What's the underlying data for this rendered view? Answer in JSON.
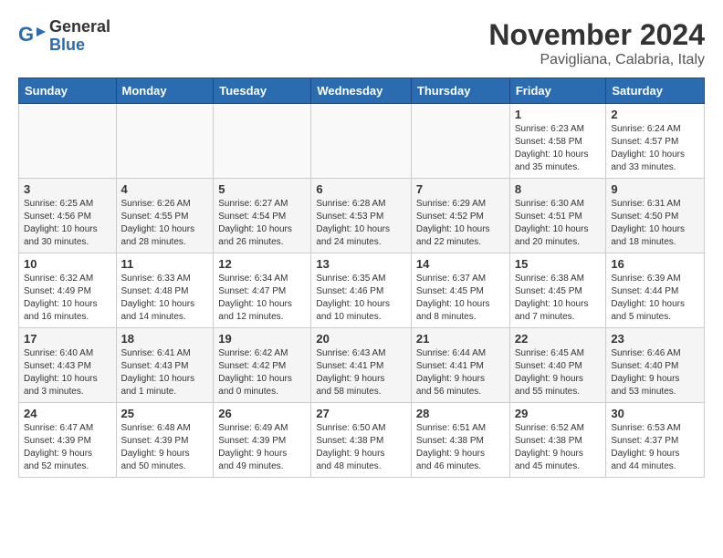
{
  "header": {
    "logo_general": "General",
    "logo_blue": "Blue",
    "month_title": "November 2024",
    "location": "Pavigliana, Calabria, Italy"
  },
  "days_of_week": [
    "Sunday",
    "Monday",
    "Tuesday",
    "Wednesday",
    "Thursday",
    "Friday",
    "Saturday"
  ],
  "weeks": [
    [
      {
        "day": "",
        "info": ""
      },
      {
        "day": "",
        "info": ""
      },
      {
        "day": "",
        "info": ""
      },
      {
        "day": "",
        "info": ""
      },
      {
        "day": "",
        "info": ""
      },
      {
        "day": "1",
        "info": "Sunrise: 6:23 AM\nSunset: 4:58 PM\nDaylight: 10 hours\nand 35 minutes."
      },
      {
        "day": "2",
        "info": "Sunrise: 6:24 AM\nSunset: 4:57 PM\nDaylight: 10 hours\nand 33 minutes."
      }
    ],
    [
      {
        "day": "3",
        "info": "Sunrise: 6:25 AM\nSunset: 4:56 PM\nDaylight: 10 hours\nand 30 minutes."
      },
      {
        "day": "4",
        "info": "Sunrise: 6:26 AM\nSunset: 4:55 PM\nDaylight: 10 hours\nand 28 minutes."
      },
      {
        "day": "5",
        "info": "Sunrise: 6:27 AM\nSunset: 4:54 PM\nDaylight: 10 hours\nand 26 minutes."
      },
      {
        "day": "6",
        "info": "Sunrise: 6:28 AM\nSunset: 4:53 PM\nDaylight: 10 hours\nand 24 minutes."
      },
      {
        "day": "7",
        "info": "Sunrise: 6:29 AM\nSunset: 4:52 PM\nDaylight: 10 hours\nand 22 minutes."
      },
      {
        "day": "8",
        "info": "Sunrise: 6:30 AM\nSunset: 4:51 PM\nDaylight: 10 hours\nand 20 minutes."
      },
      {
        "day": "9",
        "info": "Sunrise: 6:31 AM\nSunset: 4:50 PM\nDaylight: 10 hours\nand 18 minutes."
      }
    ],
    [
      {
        "day": "10",
        "info": "Sunrise: 6:32 AM\nSunset: 4:49 PM\nDaylight: 10 hours\nand 16 minutes."
      },
      {
        "day": "11",
        "info": "Sunrise: 6:33 AM\nSunset: 4:48 PM\nDaylight: 10 hours\nand 14 minutes."
      },
      {
        "day": "12",
        "info": "Sunrise: 6:34 AM\nSunset: 4:47 PM\nDaylight: 10 hours\nand 12 minutes."
      },
      {
        "day": "13",
        "info": "Sunrise: 6:35 AM\nSunset: 4:46 PM\nDaylight: 10 hours\nand 10 minutes."
      },
      {
        "day": "14",
        "info": "Sunrise: 6:37 AM\nSunset: 4:45 PM\nDaylight: 10 hours\nand 8 minutes."
      },
      {
        "day": "15",
        "info": "Sunrise: 6:38 AM\nSunset: 4:45 PM\nDaylight: 10 hours\nand 7 minutes."
      },
      {
        "day": "16",
        "info": "Sunrise: 6:39 AM\nSunset: 4:44 PM\nDaylight: 10 hours\nand 5 minutes."
      }
    ],
    [
      {
        "day": "17",
        "info": "Sunrise: 6:40 AM\nSunset: 4:43 PM\nDaylight: 10 hours\nand 3 minutes."
      },
      {
        "day": "18",
        "info": "Sunrise: 6:41 AM\nSunset: 4:43 PM\nDaylight: 10 hours\nand 1 minute."
      },
      {
        "day": "19",
        "info": "Sunrise: 6:42 AM\nSunset: 4:42 PM\nDaylight: 10 hours\nand 0 minutes."
      },
      {
        "day": "20",
        "info": "Sunrise: 6:43 AM\nSunset: 4:41 PM\nDaylight: 9 hours\nand 58 minutes."
      },
      {
        "day": "21",
        "info": "Sunrise: 6:44 AM\nSunset: 4:41 PM\nDaylight: 9 hours\nand 56 minutes."
      },
      {
        "day": "22",
        "info": "Sunrise: 6:45 AM\nSunset: 4:40 PM\nDaylight: 9 hours\nand 55 minutes."
      },
      {
        "day": "23",
        "info": "Sunrise: 6:46 AM\nSunset: 4:40 PM\nDaylight: 9 hours\nand 53 minutes."
      }
    ],
    [
      {
        "day": "24",
        "info": "Sunrise: 6:47 AM\nSunset: 4:39 PM\nDaylight: 9 hours\nand 52 minutes."
      },
      {
        "day": "25",
        "info": "Sunrise: 6:48 AM\nSunset: 4:39 PM\nDaylight: 9 hours\nand 50 minutes."
      },
      {
        "day": "26",
        "info": "Sunrise: 6:49 AM\nSunset: 4:39 PM\nDaylight: 9 hours\nand 49 minutes."
      },
      {
        "day": "27",
        "info": "Sunrise: 6:50 AM\nSunset: 4:38 PM\nDaylight: 9 hours\nand 48 minutes."
      },
      {
        "day": "28",
        "info": "Sunrise: 6:51 AM\nSunset: 4:38 PM\nDaylight: 9 hours\nand 46 minutes."
      },
      {
        "day": "29",
        "info": "Sunrise: 6:52 AM\nSunset: 4:38 PM\nDaylight: 9 hours\nand 45 minutes."
      },
      {
        "day": "30",
        "info": "Sunrise: 6:53 AM\nSunset: 4:37 PM\nDaylight: 9 hours\nand 44 minutes."
      }
    ]
  ]
}
